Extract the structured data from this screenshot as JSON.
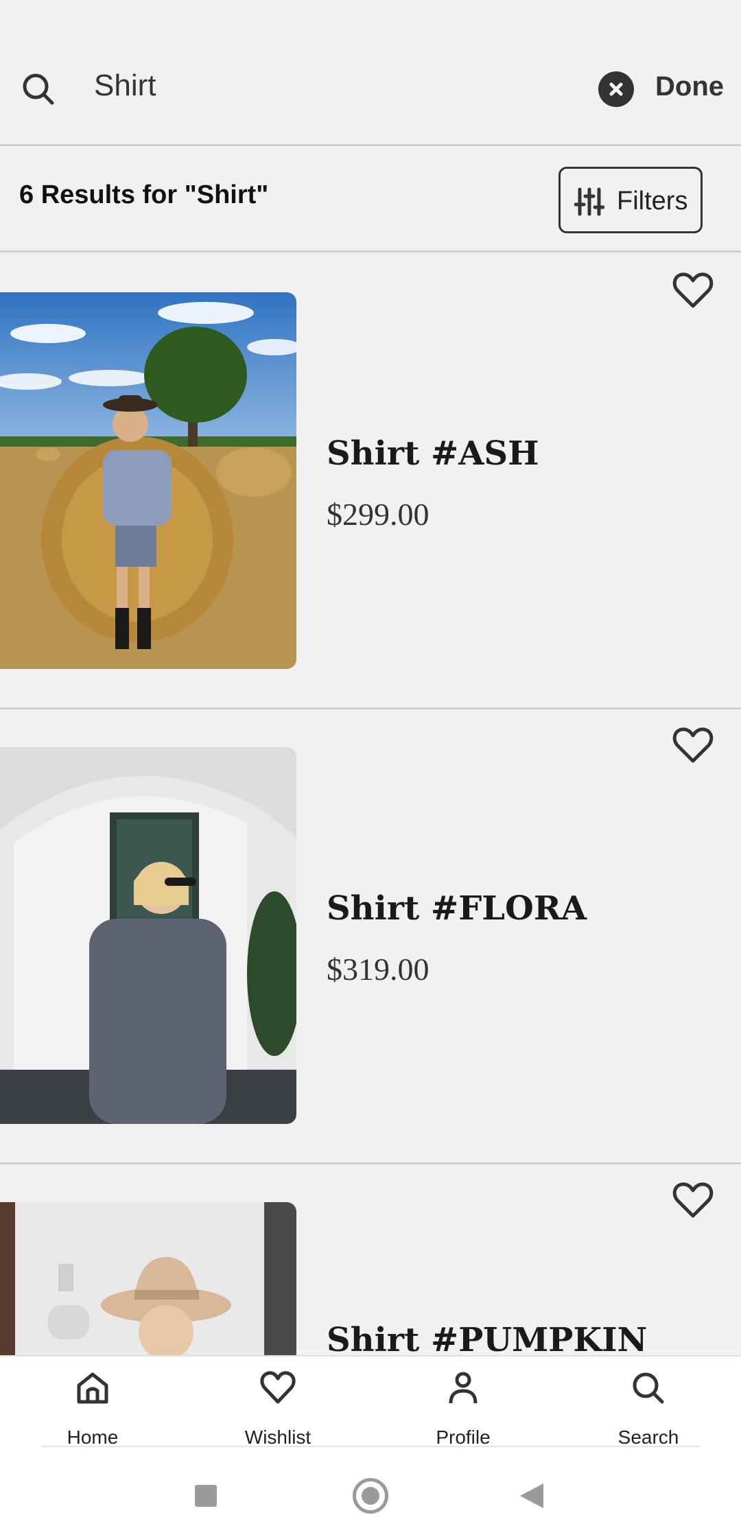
{
  "search": {
    "query": "Shirt",
    "done_label": "Done",
    "icons": {
      "search": "search-icon",
      "clear": "close-circle-icon"
    }
  },
  "results": {
    "title": "6 Results for \"Shirt\"",
    "filters_label": "Filters",
    "filters_icon": "sliders-icon"
  },
  "products": [
    {
      "name": "Shirt #ASH",
      "price": "$299.00",
      "image": "woman in grey wrap shirt in hay field"
    },
    {
      "name": "Shirt #FLORA",
      "price": "$319.00",
      "image": "woman in floral dress by white arch"
    },
    {
      "name": "Shirt #PUMPKIN",
      "price": "",
      "image": "woman in tan hat by white wall"
    }
  ],
  "bottom_nav": [
    {
      "label": "Home",
      "icon": "home-icon"
    },
    {
      "label": "Wishlist",
      "icon": "heart-icon"
    },
    {
      "label": "Profile",
      "icon": "person-icon"
    },
    {
      "label": "Search",
      "icon": "search-icon"
    }
  ],
  "colors": {
    "background": "#f1f1f1",
    "text": "#222222",
    "divider": "#d0d0d0"
  }
}
